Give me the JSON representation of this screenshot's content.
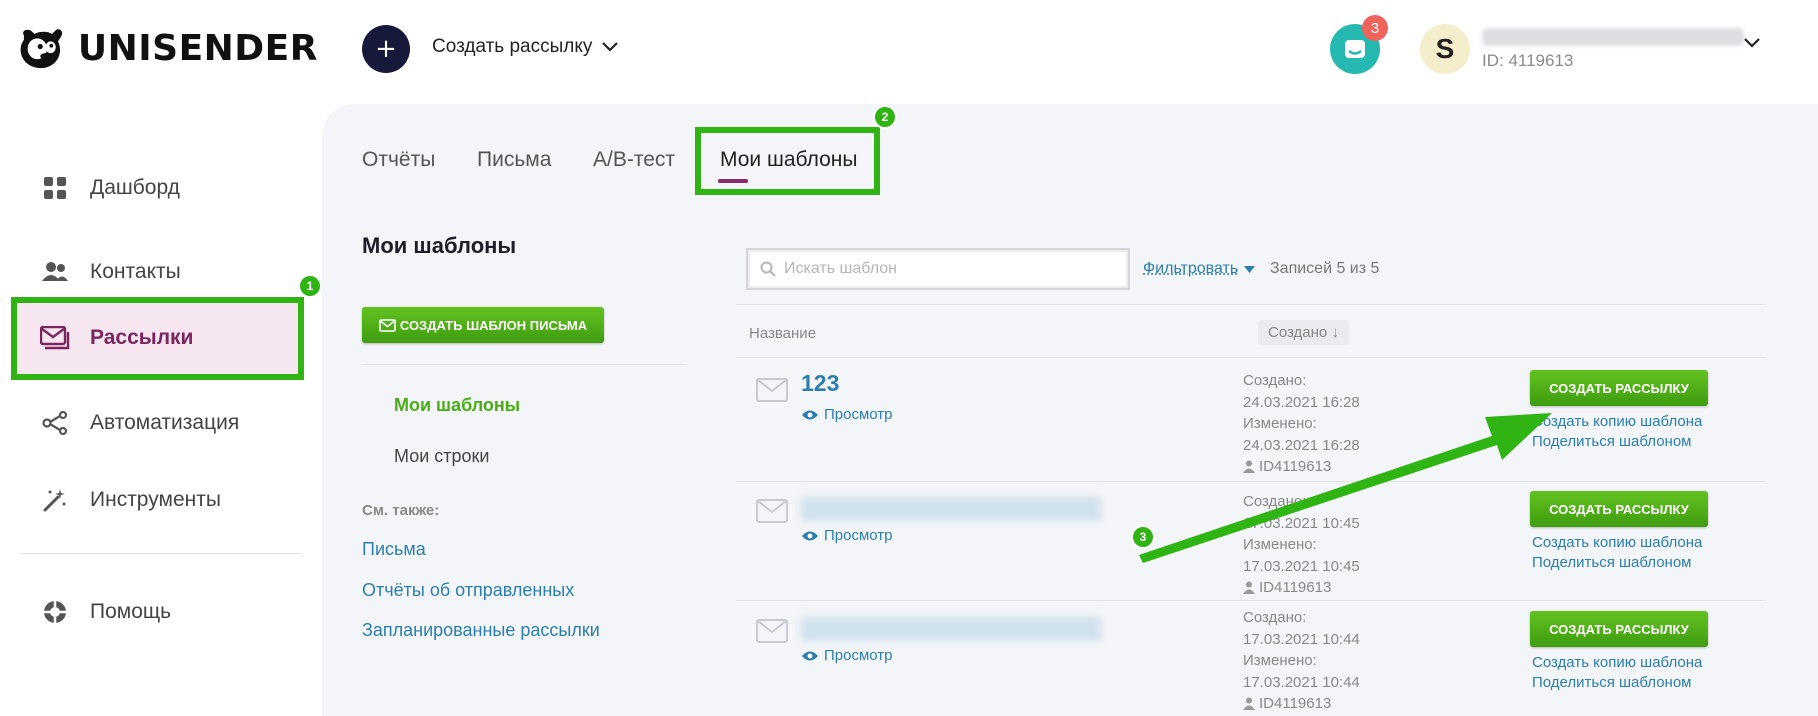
{
  "header": {
    "brand": "UNISENDER",
    "create_label": "Создать рассылку",
    "notifications_count": "3",
    "avatar_letter": "S",
    "user_id": "ID: 4119613"
  },
  "sidebar": {
    "items": [
      {
        "label": "Дашборд",
        "icon": "dashboard-icon"
      },
      {
        "label": "Контакты",
        "icon": "contacts-icon"
      },
      {
        "label": "Рассылки",
        "icon": "mailing-icon",
        "active": true
      },
      {
        "label": "Автоматизация",
        "icon": "automation-icon"
      },
      {
        "label": "Инструменты",
        "icon": "tools-icon"
      },
      {
        "label": "Помощь",
        "icon": "help-icon"
      }
    ]
  },
  "tabs": [
    {
      "label": "Отчёты"
    },
    {
      "label": "Письма"
    },
    {
      "label": "A/B-тест"
    },
    {
      "label": "Мои шаблоны",
      "active": true
    }
  ],
  "left_panel": {
    "title": "Мои шаблоны",
    "create_template_label": "СОЗДАТЬ ШАБЛОН ПИСЬМА",
    "nav": [
      {
        "label": "Мои шаблоны",
        "active": true
      },
      {
        "label": "Мои строки"
      }
    ],
    "see_also_label": "См. также:",
    "see_also_links": [
      "Письма",
      "Отчёты об отправленных",
      "Запланированные рассылки"
    ]
  },
  "toolbar": {
    "search_placeholder": "Искать шаблон",
    "filter_label": "Фильтровать",
    "records_label": "Записей 5 из 5"
  },
  "table": {
    "col_name": "Название",
    "col_created": "Создано ↓",
    "rows": [
      {
        "name": "123",
        "view_label": "Просмотр",
        "created_label": "Создано:",
        "created": "24.03.2021 16:28",
        "changed_label": "Изменено:",
        "changed": "24.03.2021 16:28",
        "author": "ID4119613",
        "action_label": "СОЗДАТЬ РАССЫЛКУ",
        "copy_label": "Создать копию шаблона",
        "share_label": "Поделиться шаблоном"
      },
      {
        "name": "",
        "view_label": "Просмотр",
        "created_label": "Создано:",
        "created": "17.03.2021 10:45",
        "changed_label": "Изменено:",
        "changed": "17.03.2021 10:45",
        "author": "ID4119613",
        "action_label": "СОЗДАТЬ РАССЫЛКУ",
        "copy_label": "Создать копию шаблона",
        "share_label": "Поделиться шаблоном"
      },
      {
        "name": "",
        "view_label": "Просмотр",
        "created_label": "Создано:",
        "created": "17.03.2021 10:44",
        "changed_label": "Изменено:",
        "changed": "17.03.2021 10:44",
        "author": "ID4119613",
        "action_label": "СОЗДАТЬ РАССЫЛКУ",
        "copy_label": "Создать копию шаблона",
        "share_label": "Поделиться шаблоном"
      }
    ]
  },
  "annotations": {
    "step1": "1",
    "step2": "2",
    "step3": "3",
    "highlight_color": "#2fb414"
  },
  "colors": {
    "accent_green": "#4aad15",
    "link_blue": "#2a7fae",
    "active_purple": "#7a2560",
    "dark_navy": "#17193a",
    "notification_teal": "#25b9b1",
    "badge_red": "#f0645e"
  }
}
